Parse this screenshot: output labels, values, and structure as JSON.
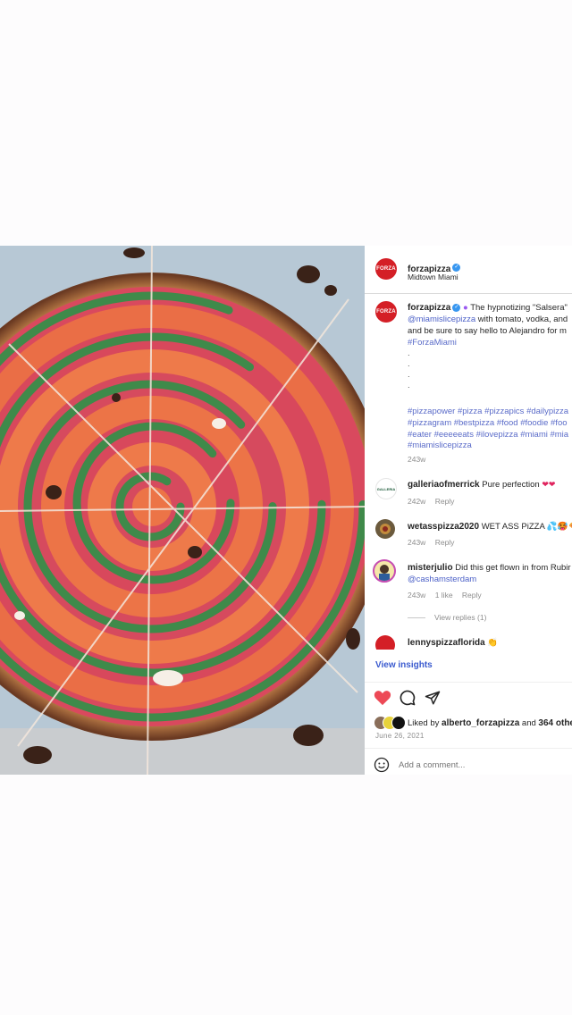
{
  "header": {
    "username": "forzapizza",
    "location": "Midtown Miami",
    "avatar_text": "FORZA"
  },
  "caption": {
    "username": "forzapizza",
    "line1": "The hypnotizing \"Salsera\"",
    "mention": "@miamislicepizza",
    "line2_rest": " with tomato, vodka, and",
    "line3": "and be sure to say hello to Alejandro for m",
    "hashtag_line": "#ForzaMiami",
    "dots": [
      ".",
      ".",
      ".",
      "."
    ],
    "tags_line1": "#pizzapower #pizza #pizzapics #dailypizza",
    "tags_line2": "#pizzagram #bestpizza #food #foodie #foo",
    "tags_line3": "#eater #eeeeeats #ilovepizza #miami #mia",
    "tags_line4": "#miamislicepizza",
    "time": "243w"
  },
  "comments": [
    {
      "username": "galleriaofmerrick",
      "text": "Pure perfection",
      "emoji": "❤❤",
      "time": "242w",
      "reply": "Reply",
      "avatar_text": "GALLERIA"
    },
    {
      "username": "wetasspizza2020",
      "text": "WET ASS PiZZA",
      "emoji": "💦🥵🍕",
      "time": "243w",
      "reply": "Reply"
    },
    {
      "username": "misterjulio",
      "text": "Did this get flown in from Rubir",
      "mention": "@cashamsterdam",
      "time": "243w",
      "likes": "1 like",
      "reply": "Reply",
      "view_replies": "View replies (1)"
    },
    {
      "username": "lennyspizzaflorida",
      "emoji": "👏"
    }
  ],
  "view_insights": "View insights",
  "likes": {
    "prefix": "Liked by ",
    "user": "alberto_forzapizza",
    "suffix": " and ",
    "count": "364 othe"
  },
  "date": "June 26, 2021",
  "add_comment_placeholder": "Add a comment...",
  "icons": {
    "like": "heart-filled-icon",
    "comment": "comment-icon",
    "share": "paper-plane-icon",
    "emoji": "smiley-icon",
    "verified": "verified-badge-icon"
  },
  "colors": {
    "like_heart": "#ed4956",
    "verified": "#3897f0",
    "link": "#4a5fc7",
    "brand_red": "#d41f26"
  }
}
